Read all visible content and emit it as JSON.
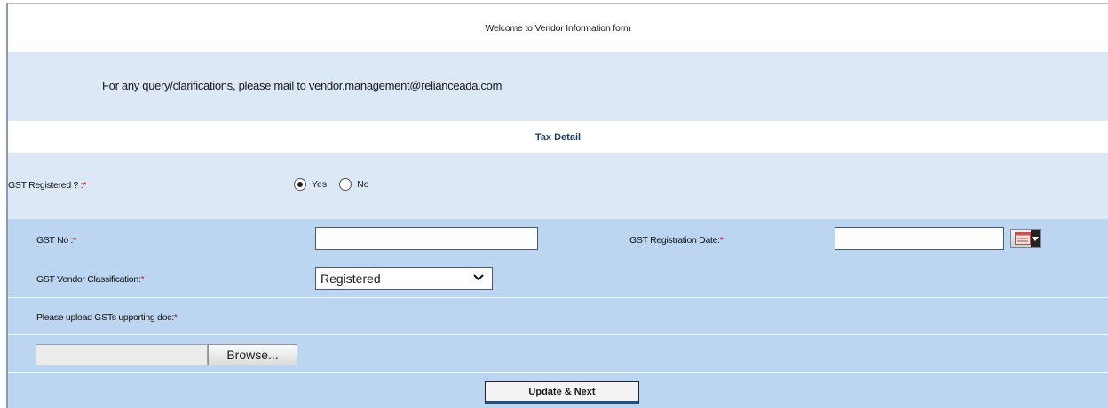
{
  "header": {
    "welcome": "Welcome to Vendor Information form",
    "query_note": "For any query/clarifications, please mail to vendor.management@relianceada.com"
  },
  "section": {
    "title": "Tax Detail"
  },
  "form": {
    "gst_registered": {
      "label": "GST Registered ? :",
      "required_mark": "*",
      "options": [
        "Yes",
        "No"
      ],
      "selected": "Yes"
    },
    "gst_no": {
      "label": "GST No :",
      "required_mark": "*",
      "value": ""
    },
    "gst_registration_date": {
      "label": "GST Registration Date:",
      "required_mark": "*",
      "value": ""
    },
    "gst_vendor_classification": {
      "label": "GST Vendor Classification:",
      "required_mark": "*",
      "selected": "Registered"
    },
    "gst_supporting_doc": {
      "label": "Please upload GSTs upporting doc:",
      "required_mark": "*",
      "browse_label": "Browse..."
    },
    "submit_label": "Update & Next"
  },
  "icons": {
    "calendar": "calendar-icon",
    "dropdown": "chevron-down-icon"
  },
  "colors": {
    "pale_band": "#dce8f6",
    "blue_band": "#bcd6f1",
    "required": "#dd1111"
  }
}
